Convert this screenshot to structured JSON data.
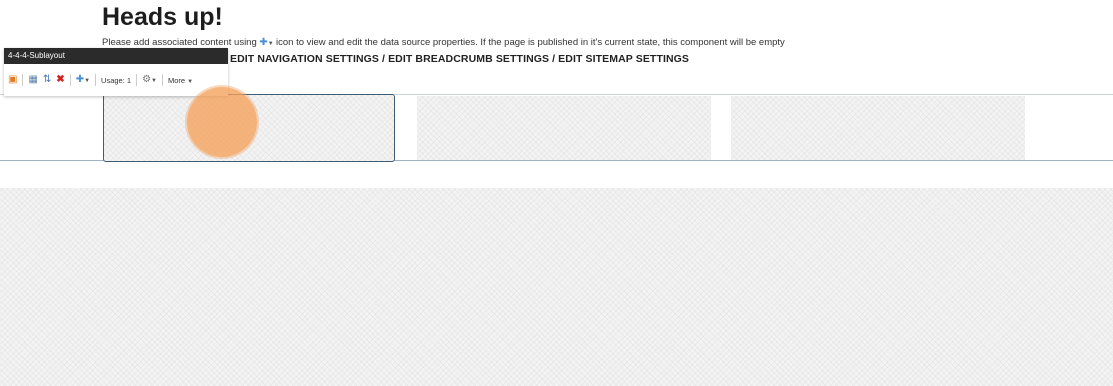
{
  "heading": "Heads up!",
  "notice": {
    "before_icon": "Please add associated content using",
    "icon": "datasource-icon",
    "after_icon": "icon to view and edit the data source properties. If the page is published in it's current state, this component will be empty"
  },
  "nav_links": "EDIT NAVIGATION SETTINGS / EDIT BREADCRUMB SETTINGS / EDIT SITEMAP SETTINGS",
  "rendering_panel": {
    "title": "4-4-4-Sublayout",
    "usage_label": "Usage: 1",
    "more_label": "More"
  },
  "colors": {
    "click_indicator": "#f5a05a",
    "panel_header": "#2b2b2b",
    "column_border": "#3f5a73"
  }
}
